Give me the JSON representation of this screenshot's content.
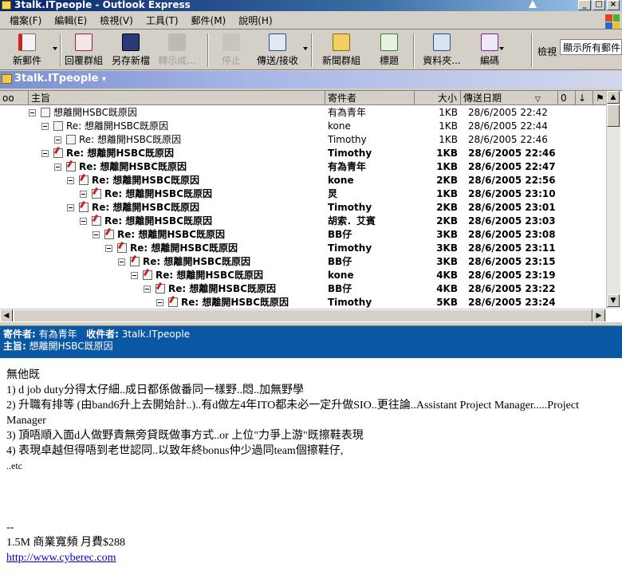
{
  "window": {
    "title": "3talk.ITpeople - Outlook Express"
  },
  "menu": [
    "檔案(F)",
    "編輯(E)",
    "檢視(V)",
    "工具(T)",
    "郵件(M)",
    "說明(H)"
  ],
  "toolbar": {
    "new_mail": "新郵件",
    "reply_group": "回覆群組",
    "save_new": "另存新檔",
    "forward": "轉示成...",
    "stop": "停止",
    "send_receive": "傳送/接收",
    "newsgroups": "新聞群組",
    "headers": "標題",
    "folders": "資料夾...",
    "encode": "編碼",
    "view_label": "檢視",
    "view_value": "顯示所有郵件"
  },
  "folder": {
    "name": "3talk.ITpeople"
  },
  "columns": {
    "subject": "主旨",
    "sender": "寄件者",
    "size": "大小",
    "date": "傳送日期"
  },
  "messages": [
    {
      "subject": "想離開HSBC既原因",
      "sender": "有為青年",
      "size": "1KB",
      "date": "28/6/2005 22:42",
      "bold": false,
      "depth": 0
    },
    {
      "subject": "Re: 想離開HSBC既原因",
      "sender": "kone",
      "size": "1KB",
      "date": "28/6/2005 22:44",
      "bold": false,
      "depth": 1
    },
    {
      "subject": "Re: 想離開HSBC既原因",
      "sender": "Timothy",
      "size": "1KB",
      "date": "28/6/2005 22:46",
      "bold": false,
      "depth": 2
    },
    {
      "subject": "Re: 想離開HSBC既原因",
      "sender": "Timothy",
      "size": "1KB",
      "date": "28/6/2005 22:46",
      "bold": true,
      "depth": 1
    },
    {
      "subject": "Re: 想離開HSBC既原因",
      "sender": "有為青年",
      "size": "1KB",
      "date": "28/6/2005 22:47",
      "bold": true,
      "depth": 2
    },
    {
      "subject": "Re: 想離開HSBC既原因",
      "sender": "kone",
      "size": "2KB",
      "date": "28/6/2005 22:56",
      "bold": true,
      "depth": 3
    },
    {
      "subject": "Re: 想離開HSBC既原因",
      "sender": "炅",
      "size": "1KB",
      "date": "28/6/2005 23:10",
      "bold": true,
      "depth": 4
    },
    {
      "subject": "Re: 想離開HSBC既原因",
      "sender": "Timothy",
      "size": "2KB",
      "date": "28/6/2005 23:01",
      "bold": true,
      "depth": 3
    },
    {
      "subject": "Re: 想離開HSBC既原因",
      "sender": "胡索．艾賓",
      "size": "2KB",
      "date": "28/6/2005 23:03",
      "bold": true,
      "depth": 4
    },
    {
      "subject": "Re: 想離開HSBC既原因",
      "sender": "BB仔",
      "size": "3KB",
      "date": "28/6/2005 23:08",
      "bold": true,
      "depth": 5
    },
    {
      "subject": "Re: 想離開HSBC既原因",
      "sender": "Timothy",
      "size": "3KB",
      "date": "28/6/2005 23:11",
      "bold": true,
      "depth": 6
    },
    {
      "subject": "Re: 想離開HSBC既原因",
      "sender": "BB仔",
      "size": "3KB",
      "date": "28/6/2005 23:15",
      "bold": true,
      "depth": 7
    },
    {
      "subject": "Re: 想離開HSBC既原因",
      "sender": "kone",
      "size": "4KB",
      "date": "28/6/2005 23:19",
      "bold": true,
      "depth": 8
    },
    {
      "subject": "Re: 想離開HSBC既原因",
      "sender": "BB仔",
      "size": "4KB",
      "date": "28/6/2005 23:22",
      "bold": true,
      "depth": 9
    },
    {
      "subject": "Re: 想離開HSBC既原因",
      "sender": "Timothy",
      "size": "5KB",
      "date": "28/6/2005 23:24",
      "bold": true,
      "depth": 10
    }
  ],
  "preview": {
    "from_label": "寄件者:",
    "from": "有為青年",
    "to_label": "收件者:",
    "to": "3talk.ITpeople",
    "subject_label": "主旨:",
    "subject": "想離開HSBC既原因",
    "lines": [
      "無他既",
      "1) d job duty分得太仔細..成日都係做番同一樣野..悶..加無野學",
      "2) 升職有排等 (由band6升上去開始計..)..有d做左4年ITO都未必一定升做SIO..更往論..Assistant Project Manager.....Project Manager",
      "3) 頂唔順入面d人做野責無旁貸既做事方式..or 上位\"力爭上游\"既擦鞋表現",
      "4) 表現卓越但得唔到老世認同..以致年終bonus仲少過同team個擦鞋仔,",
      "..etc"
    ],
    "sig_dash": "--",
    "sig_line": "1.5M 商業寬頻 月費$288",
    "sig_link": "http://www.cyberec.com"
  }
}
